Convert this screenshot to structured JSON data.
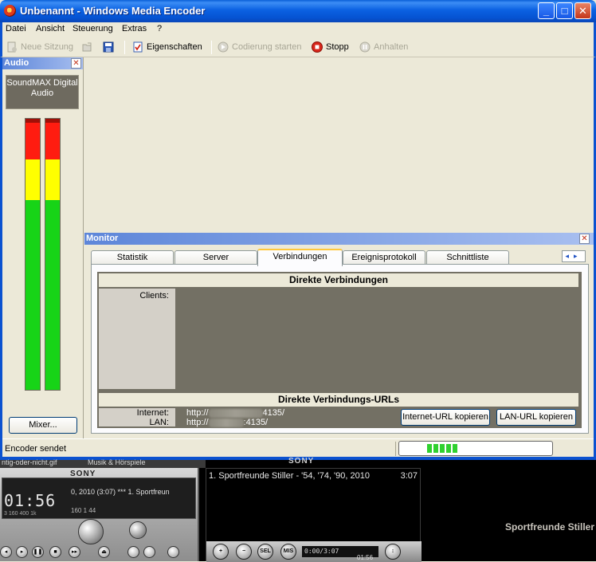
{
  "window": {
    "title": "Unbenannt - Windows Media Encoder",
    "controls": {
      "minimize": "_",
      "maximize": "□",
      "close": "✕"
    }
  },
  "menu": {
    "items": [
      "Datei",
      "Ansicht",
      "Steuerung",
      "Extras",
      "?"
    ]
  },
  "toolbar": {
    "new_session": "Neue Sitzung",
    "properties": "Eigenschaften",
    "start_encoding": "Codierung starten",
    "stop": "Stopp",
    "pause": "Anhalten"
  },
  "audio_panel": {
    "title": "Audio",
    "device": "SoundMAX Digital Audio",
    "mixer_button": "Mixer...",
    "meter_colors": {
      "high": "#ff1c10",
      "mid": "#ffff00",
      "low": "#17d417"
    }
  },
  "monitor": {
    "title": "Monitor",
    "tabs": [
      "Statistik",
      "Server",
      "Verbindungen",
      "Ereignisprotokoll",
      "Schnittliste"
    ],
    "active_tab": "Verbindungen",
    "direct_connections_header": "Direkte Verbindungen",
    "clients_label": "Clients:",
    "urls_header": "Direkte Verbindungs-URLs",
    "internet_label": "Internet:",
    "lan_label": "LAN:",
    "internet_url_prefix": "http://",
    "internet_url_suffix": "4135/",
    "lan_url_prefix": "http://",
    "lan_url_suffix": ":4135/",
    "copy_internet_button": "Internet-URL kopieren",
    "copy_lan_button": "LAN-URL kopieren"
  },
  "statusbar": {
    "status_text": "Encoder sendet",
    "progress_blocks": 5
  },
  "sony_player": {
    "tab_file": "ntig-oder-nicht.gif",
    "tab_category": "Musik & Hörspiele",
    "brand": "SONY",
    "time_display": "01:56",
    "track_info": "0, 2010 (3:07) *** 1. Sportfreun",
    "lcd_numbers": "160   1   44",
    "lcd_scale": "3   160   400   1k",
    "playlist_item": "1. Sportfreunde Stiller - '54, '74, '90, 2010",
    "playlist_duration": "3:07",
    "counter": "0:00/3:07",
    "counter2": "01:56",
    "btn_add": "+",
    "btn_remove": "−",
    "btn_sel": "SEL",
    "btn_mis": "MIS",
    "artist": "Sportfreunde Stiller"
  }
}
